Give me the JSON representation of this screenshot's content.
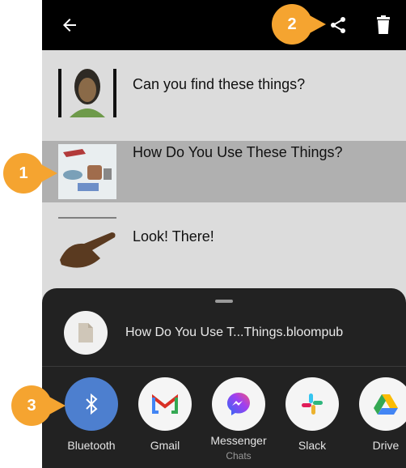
{
  "callouts": [
    "1",
    "2",
    "3"
  ],
  "list": {
    "items": [
      {
        "title": "Can you find these things?"
      },
      {
        "title": "How Do You Use These Things?"
      },
      {
        "title": "Look! There!"
      }
    ]
  },
  "share_sheet": {
    "file_name": "How Do You Use T...Things.bloompub",
    "apps": [
      {
        "label": "Bluetooth",
        "sub": ""
      },
      {
        "label": "Gmail",
        "sub": ""
      },
      {
        "label": "Messenger",
        "sub": "Chats"
      },
      {
        "label": "Slack",
        "sub": ""
      },
      {
        "label": "Drive",
        "sub": ""
      }
    ]
  },
  "colors": {
    "accent_orange": "#f5a430",
    "selected_row": "#b0b0b0",
    "sheet_bg": "#222222",
    "bluetooth_bg": "#4d7fcf"
  }
}
